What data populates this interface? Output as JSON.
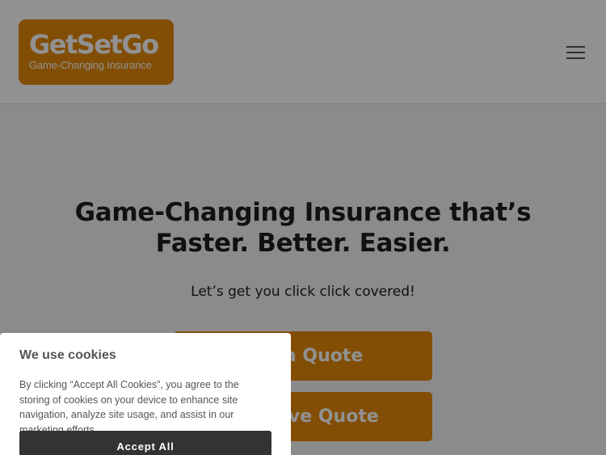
{
  "header": {
    "logo": {
      "name": "GetSetGo",
      "tagline": "Game-Changing Insurance"
    },
    "menu_icon": "hamburger-menu-icon"
  },
  "hero": {
    "title_line1": "Game-Changing Insurance that’s",
    "title_line2": "Faster. Better. Easier.",
    "subtitle": "Let’s get you click click covered!",
    "cta_get_quote": "Get a Quote",
    "cta_saved_quote": "Retrieve Quote"
  },
  "cookie_banner": {
    "title": "We use cookies",
    "text": "By clicking “Accept All Cookies”, you agree to the storing of cookies on your device to enhance site navigation, analyze site usage, and assist in our marketing efforts.",
    "accept_label": "Accept All"
  },
  "colors": {
    "brand": "#e58a0c",
    "text_dark": "#1e1e1e",
    "button_dark": "#333333"
  }
}
